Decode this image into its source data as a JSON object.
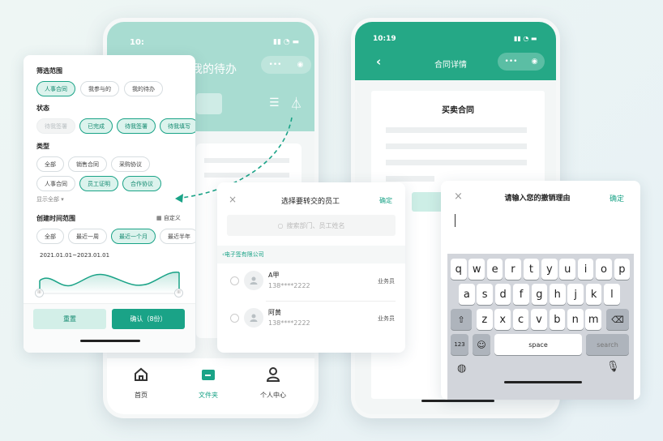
{
  "phone1": {
    "time": "10:",
    "title_partial": "我的待办",
    "nav": [
      {
        "label": "首页"
      },
      {
        "label": "文件夹"
      },
      {
        "label": "个人中心"
      }
    ]
  },
  "phone2": {
    "time": "10:19",
    "title": "合同详情",
    "doc_title": "买卖合同"
  },
  "filter": {
    "range_title": "筛选范围",
    "range_chips": [
      "人事合同",
      "我参与的",
      "我的待办"
    ],
    "status_title": "状态",
    "status_chips": [
      "待我签署",
      "已完成",
      "待我签署",
      "待我填写"
    ],
    "type_title": "类型",
    "type_chips": [
      "全部",
      "销售合同",
      "采购协议",
      "人事合同",
      "员工证明",
      "合作协议"
    ],
    "show_all": "显示全部",
    "time_title": "创建时间范围",
    "custom_label": "自定义",
    "time_chips": [
      "全部",
      "最近一周",
      "最近一个月",
      "最近半年"
    ],
    "date_range": "2021.01.01~2023.01.01",
    "reset_label": "重置",
    "confirm_label": "确认（8份）"
  },
  "employee": {
    "title": "选择要转交的员工",
    "confirm_label": "确定",
    "search_placeholder": "搜索部门、员工姓名",
    "company": "电子签有限公司",
    "people": [
      {
        "name": "A甲",
        "phone": "138****2222",
        "role": "业务员"
      },
      {
        "name": "阿黄",
        "phone": "138****2222",
        "role": "业务员"
      }
    ]
  },
  "revoke": {
    "title": "请输入您的撤销理由",
    "confirm_label": "确定",
    "keyboard": {
      "row1": [
        "q",
        "w",
        "e",
        "r",
        "t",
        "y",
        "u",
        "i",
        "o",
        "p"
      ],
      "row2": [
        "a",
        "s",
        "d",
        "f",
        "g",
        "h",
        "j",
        "k",
        "l"
      ],
      "row3": [
        "z",
        "x",
        "c",
        "v",
        "b",
        "n",
        "m"
      ],
      "num_label": "123",
      "space_label": "space",
      "search_label": "search"
    }
  },
  "colors": {
    "accent": "#1aa387",
    "header": "#a8dcd1",
    "green_header": "#25a886"
  }
}
